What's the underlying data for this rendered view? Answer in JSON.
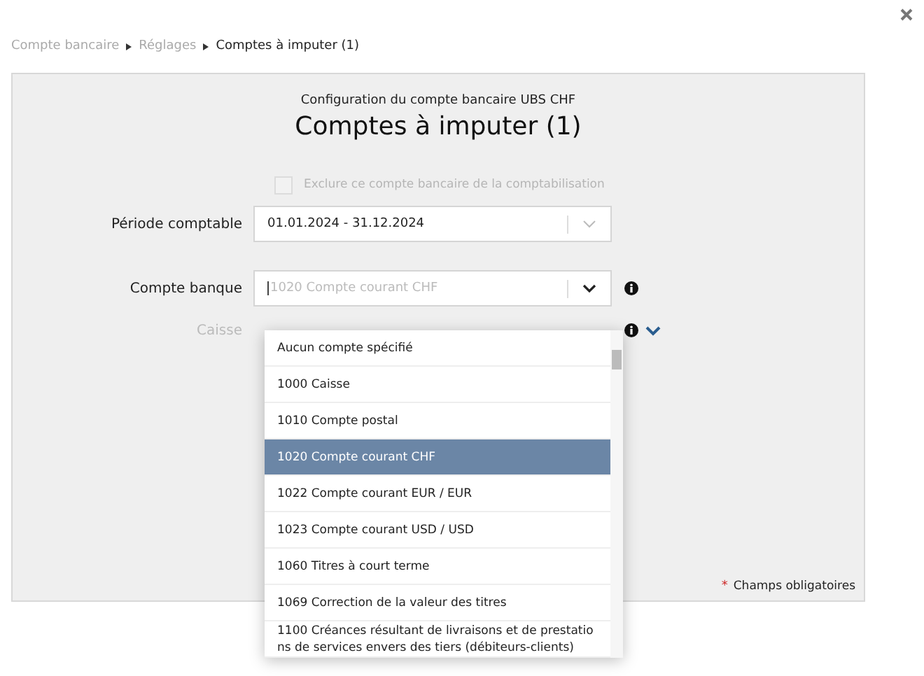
{
  "breadcrumb": [
    {
      "label": "Compte bancaire",
      "current": false
    },
    {
      "label": "Réglages",
      "current": false
    },
    {
      "label": "Comptes à imputer (1)",
      "current": true
    }
  ],
  "panel": {
    "subtitle": "Configuration du compte bancaire UBS CHF",
    "title": "Comptes à imputer (1)"
  },
  "exclude_checkbox": {
    "label": "Exclure ce compte bancaire de la comptabilisation",
    "checked": false,
    "disabled": true
  },
  "fields": [
    {
      "label": "Période comptable",
      "value": "01.01.2024 - 31.12.2024",
      "disabled": false
    },
    {
      "label": "Compte banque",
      "placeholder": "1020 Compte courant CHF",
      "disabled": false,
      "open": true,
      "info": true
    },
    {
      "label": "Caisse",
      "disabled": true,
      "info": true
    }
  ],
  "dropdown_options": [
    {
      "label": "Aucun compte spécifié",
      "selected": false
    },
    {
      "label": "1000 Caisse",
      "selected": false
    },
    {
      "label": "1010 Compte postal",
      "selected": false
    },
    {
      "label": "1020 Compte courant CHF",
      "selected": true
    },
    {
      "label": "1022 Compte courant EUR / EUR",
      "selected": false
    },
    {
      "label": "1023 Compte courant USD / USD",
      "selected": false
    },
    {
      "label": "1060 Titres à court terme",
      "selected": false
    },
    {
      "label": "1069 Correction de la valeur des titres",
      "selected": false
    },
    {
      "label": "1100 Créances résultant de livraisons et de prestations de services envers des tiers (débiteurs-clients)",
      "selected": false
    }
  ],
  "required_note": {
    "marker": "*",
    "text": "Champs obligatoires"
  }
}
